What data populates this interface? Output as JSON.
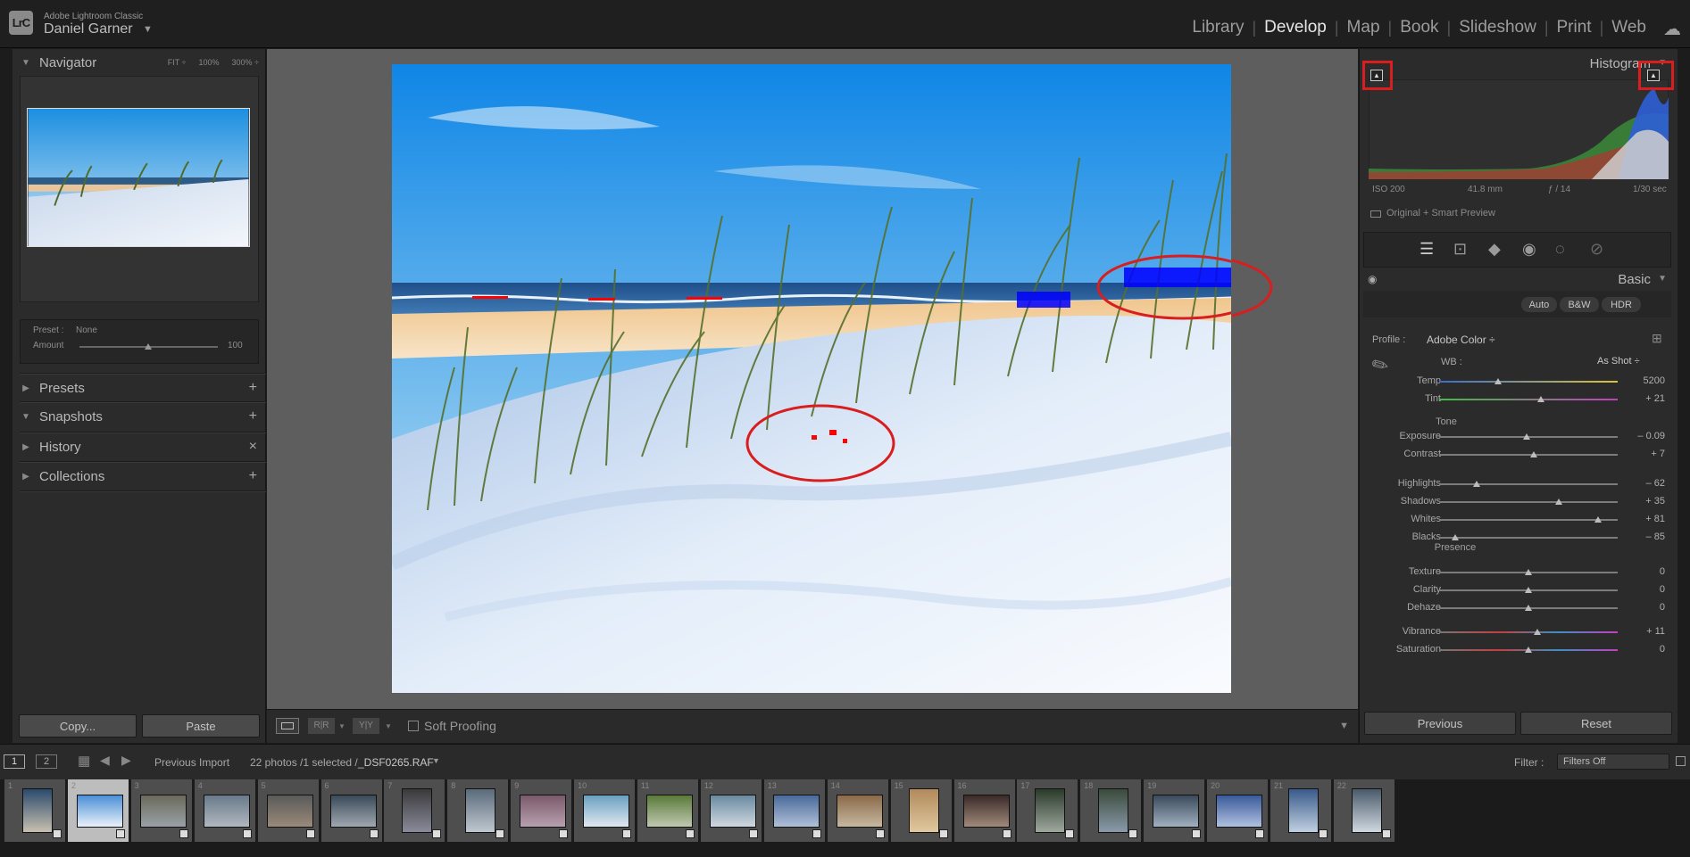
{
  "app": {
    "product": "Adobe Lightroom Classic",
    "user": "Daniel Garner",
    "logo_text": "LrC"
  },
  "modules": [
    "Library",
    "Develop",
    "Map",
    "Book",
    "Slideshow",
    "Print",
    "Web"
  ],
  "active_module": "Develop",
  "left_panel": {
    "navigator": {
      "title": "Navigator",
      "zoom_options": [
        "FIT ÷",
        "100%",
        "300% ÷"
      ]
    },
    "preset": {
      "preset_label": "Preset :",
      "preset_value": "None",
      "amount_label": "Amount",
      "amount_value": "100"
    },
    "sections": [
      {
        "label": "Presets",
        "action": "+"
      },
      {
        "label": "Snapshots",
        "action": "+"
      },
      {
        "label": "History",
        "action": "×"
      },
      {
        "label": "Collections",
        "action": "+"
      }
    ],
    "copy_label": "Copy...",
    "paste_label": "Paste"
  },
  "toolbar": {
    "soft_proofing": "Soft Proofing"
  },
  "right_panel": {
    "histogram_title": "Histogram",
    "exif": {
      "iso": "ISO 200",
      "focal": "41.8 mm",
      "aperture": "ƒ / 14",
      "shutter": "1/30 sec"
    },
    "preview_status": "Original + Smart Preview",
    "basic_title": "Basic",
    "treatment_buttons": [
      "Auto",
      "B&W",
      "HDR"
    ],
    "profile_label": "Profile :",
    "profile_value": "Adobe Color ÷",
    "wb_label": "WB :",
    "wb_value": "As Shot ÷",
    "tone_label": "Tone",
    "presence_label": "Presence",
    "sliders": {
      "temp": {
        "label": "Temp",
        "value": "5200",
        "pos": 0.33
      },
      "tint": {
        "label": "Tint",
        "value": "+ 21",
        "pos": 0.57
      },
      "exposure": {
        "label": "Exposure",
        "value": "– 0.09",
        "pos": 0.49
      },
      "contrast": {
        "label": "Contrast",
        "value": "+ 7",
        "pos": 0.53
      },
      "highlights": {
        "label": "Highlights",
        "value": "– 62",
        "pos": 0.21
      },
      "shadows": {
        "label": "Shadows",
        "value": "+ 35",
        "pos": 0.67
      },
      "whites": {
        "label": "Whites",
        "value": "+ 81",
        "pos": 0.89
      },
      "blacks": {
        "label": "Blacks",
        "value": "– 85",
        "pos": 0.09
      },
      "texture": {
        "label": "Texture",
        "value": "0",
        "pos": 0.5
      },
      "clarity": {
        "label": "Clarity",
        "value": "0",
        "pos": 0.5
      },
      "dehaze": {
        "label": "Dehaze",
        "value": "0",
        "pos": 0.5
      },
      "vibrance": {
        "label": "Vibrance",
        "value": "+ 11",
        "pos": 0.55
      },
      "saturation": {
        "label": "Saturation",
        "value": "0",
        "pos": 0.5
      }
    },
    "previous_label": "Previous",
    "reset_label": "Reset"
  },
  "filmstrip_bar": {
    "screen1": "1",
    "screen2": "2",
    "source": "Previous Import",
    "count": "22 photos /1 selected /",
    "filename": "_DSF0265.RAF",
    "filter_label": "Filter :",
    "filter_value": "Filters Off"
  },
  "thumbnails": [
    "1",
    "2",
    "3",
    "4",
    "5",
    "6",
    "7",
    "8",
    "9",
    "10",
    "11",
    "12",
    "13",
    "14",
    "15",
    "16",
    "17",
    "18",
    "19",
    "20",
    "21",
    "22"
  ],
  "selected_thumbnail": "2",
  "colors": {
    "accent_red_marker": "#d81e1e",
    "panel_bg": "#2b2b2b",
    "canvas_bg": "#5e5e5e"
  }
}
